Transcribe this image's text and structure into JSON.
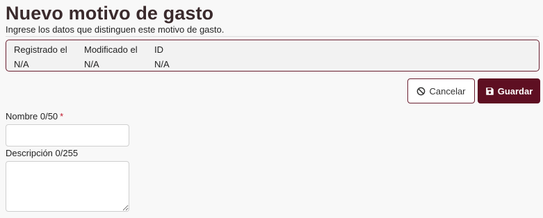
{
  "header": {
    "title": "Nuevo motivo de gasto",
    "subtitle": "Ingrese los datos que distinguen este motivo de gasto."
  },
  "meta": {
    "registered_label": "Registrado el",
    "registered_value": "N/A",
    "modified_label": "Modificado el",
    "modified_value": "N/A",
    "id_label": "ID",
    "id_value": "N/A"
  },
  "actions": {
    "cancel_label": "Cancelar",
    "cancel_icon": "ban-icon",
    "save_label": "Guardar",
    "save_icon": "floppy-disk-icon"
  },
  "form": {
    "name_label": "Nombre 0/50",
    "name_required_mark": "*",
    "name_value": "",
    "description_label": "Descripción 0/255",
    "description_value": ""
  },
  "colors": {
    "brand": "#5e0f22",
    "required": "#c0162b",
    "title": "#3a2a2c"
  }
}
